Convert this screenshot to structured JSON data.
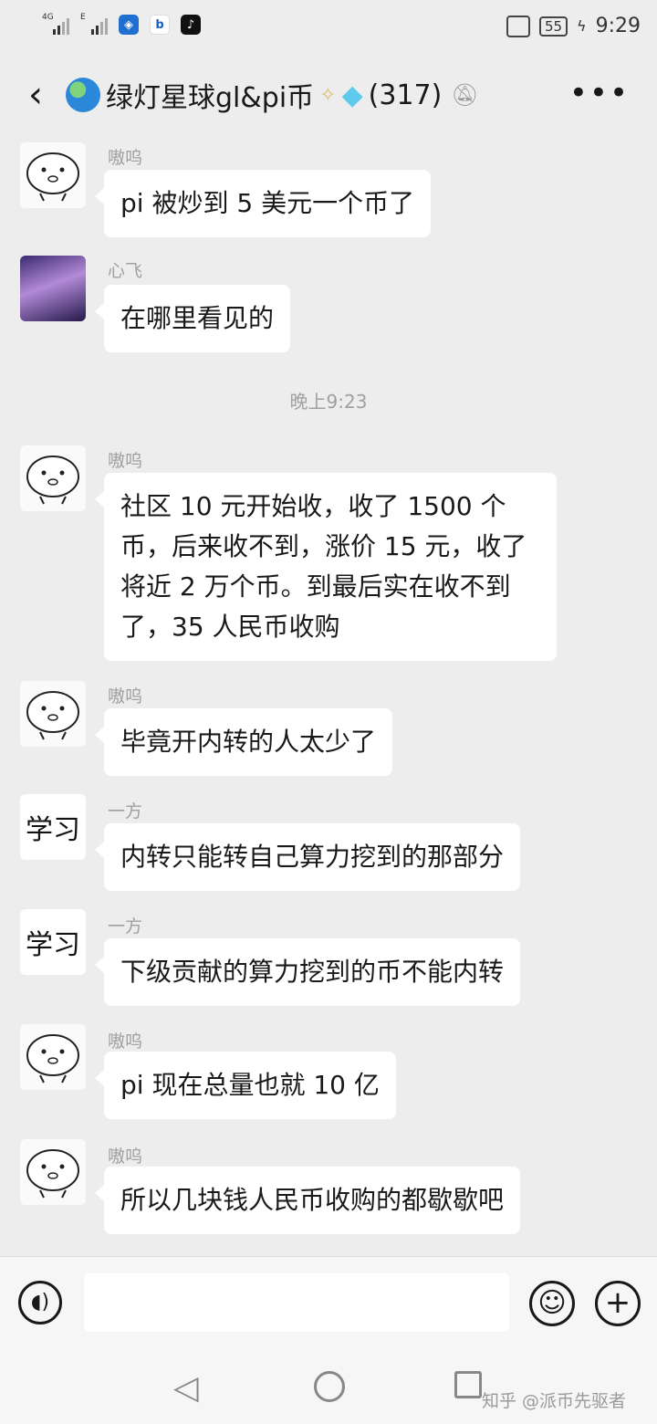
{
  "status_bar": {
    "signal1_tag": "4G",
    "signal2_tag": "E",
    "battery": "55",
    "time": "9:29"
  },
  "header": {
    "group_name": "绿灯星球gl&pi币",
    "member_count": "(317)"
  },
  "messages": [
    {
      "sender": "嗷呜",
      "text": "pi 被炒到 5 美元一个币了"
    },
    {
      "sender": "心飞",
      "text": "在哪里看见的"
    },
    {
      "sender": "嗷呜",
      "text": "社区 10 元开始收，收了 1500 个币，后来收不到，涨价 15 元，收了将近 2 万个币。到最后实在收不到了，35 人民币收购"
    },
    {
      "sender": "嗷呜",
      "text": "毕竟开内转的人太少了"
    },
    {
      "sender": "一方",
      "text": "内转只能转自己算力挖到的那部分"
    },
    {
      "sender": "一方",
      "text": "下级贡献的算力挖到的币不能内转"
    },
    {
      "sender": "嗷呜",
      "text": "pi 现在总量也就 10 亿"
    },
    {
      "sender": "嗷呜",
      "text": "所以几块钱人民币收购的都歇歇吧"
    }
  ],
  "timestamp": "晚上9:23",
  "avatar_xue_text": "学习",
  "watermark": "知乎 @派币先驱者",
  "colors": {
    "background": "#ededed",
    "bubble": "#ffffff",
    "sender_name": "#a0a0a0"
  }
}
